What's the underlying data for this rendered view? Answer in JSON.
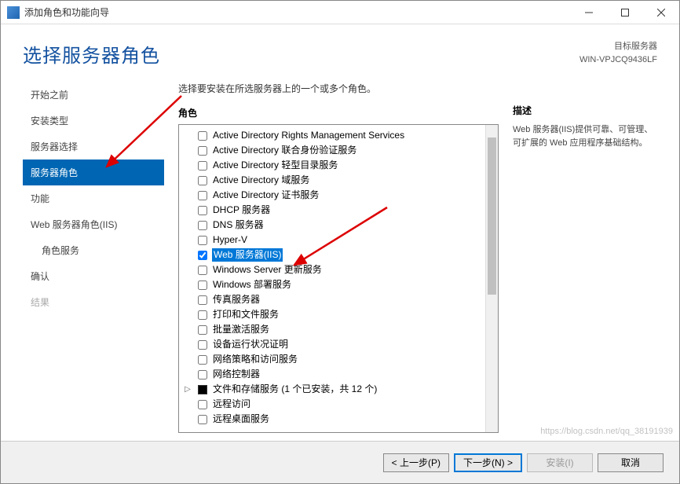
{
  "window": {
    "title": "添加角色和功能向导"
  },
  "header": {
    "title": "选择服务器角色",
    "target_label": "目标服务器",
    "target_server": "WIN-VPJCQ9436LF"
  },
  "sidebar": {
    "items": [
      {
        "label": "开始之前",
        "selected": false
      },
      {
        "label": "安装类型",
        "selected": false
      },
      {
        "label": "服务器选择",
        "selected": false
      },
      {
        "label": "服务器角色",
        "selected": true
      },
      {
        "label": "功能",
        "selected": false
      },
      {
        "label": "Web 服务器角色(IIS)",
        "selected": false
      },
      {
        "label": "角色服务",
        "selected": false,
        "indent": true
      },
      {
        "label": "确认",
        "selected": false
      },
      {
        "label": "结果",
        "selected": false,
        "disabled": true
      }
    ]
  },
  "main": {
    "instruction": "选择要安装在所选服务器上的一个或多个角色。",
    "roles_label": "角色",
    "roles": [
      {
        "label": "Active Directory Rights Management Services",
        "checked": false
      },
      {
        "label": "Active Directory 联合身份验证服务",
        "checked": false
      },
      {
        "label": "Active Directory 轻型目录服务",
        "checked": false
      },
      {
        "label": "Active Directory 域服务",
        "checked": false
      },
      {
        "label": "Active Directory 证书服务",
        "checked": false
      },
      {
        "label": "DHCP 服务器",
        "checked": false
      },
      {
        "label": "DNS 服务器",
        "checked": false
      },
      {
        "label": "Hyper-V",
        "checked": false
      },
      {
        "label": "Web 服务器(IIS)",
        "checked": true,
        "selected": true
      },
      {
        "label": "Windows Server 更新服务",
        "checked": false
      },
      {
        "label": "Windows 部署服务",
        "checked": false
      },
      {
        "label": "传真服务器",
        "checked": false
      },
      {
        "label": "打印和文件服务",
        "checked": false
      },
      {
        "label": "批量激活服务",
        "checked": false
      },
      {
        "label": "设备运行状况证明",
        "checked": false
      },
      {
        "label": "网络策略和访问服务",
        "checked": false
      },
      {
        "label": "网络控制器",
        "checked": false
      },
      {
        "label": "文件和存储服务 (1 个已安装，共 12 个)",
        "checked": "partial",
        "expandable": true
      },
      {
        "label": "远程访问",
        "checked": false
      },
      {
        "label": "远程桌面服务",
        "checked": false
      }
    ]
  },
  "description": {
    "title": "描述",
    "text": "Web 服务器(IIS)提供可靠、可管理、可扩展的 Web 应用程序基础结构。"
  },
  "footer": {
    "prev": "< 上一步(P)",
    "next": "下一步(N) >",
    "install": "安装(I)",
    "cancel": "取消"
  },
  "watermark": "https://blog.csdn.net/qq_38191939"
}
